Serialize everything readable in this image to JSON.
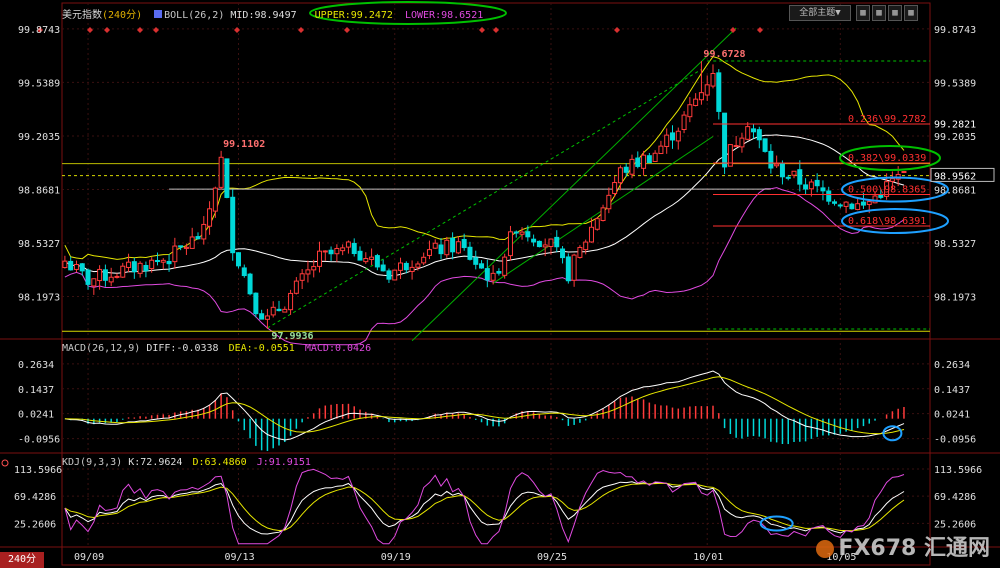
{
  "header": {
    "title": "美元指数",
    "period": "(240分)",
    "boll_label": "BOLL(26,2)",
    "mid": "MID:98.9497",
    "upper": "UPPER:99.2472",
    "lower": "LOWER:98.6521",
    "all_themes": "全部主题▼"
  },
  "macd_header": {
    "label": "MACD(26,12,9)",
    "diff": "DIFF:-0.0338",
    "dea": "DEA:-0.0551",
    "macd": "MACD:0.0426"
  },
  "kdj_header": {
    "label": "KDJ(9,3,3)",
    "k": "K:72.9624",
    "d": "D:63.4860",
    "j": "J:91.9151"
  },
  "period_badge": "240分",
  "watermark": "FX678 汇通网",
  "colors": {
    "up": "#ff3b3b",
    "down": "#00d8d8",
    "mid": "#ffffff",
    "upper": "#e6e600",
    "lower": "#e04ae0",
    "fib": "#ff3030",
    "highlight_green": "#00c000",
    "highlight_blue": "#1ea0ff"
  },
  "chart_data": [
    {
      "type": "candlestick",
      "title": "美元指数 (240分)",
      "y_ticks": [
        "99.8743",
        "99.5389",
        "99.2035",
        "98.8681",
        "98.5327",
        "98.1973"
      ],
      "y_tick_values": [
        99.8743,
        99.5389,
        99.2035,
        98.8681,
        98.5327,
        98.1973
      ],
      "ylim": [
        97.95,
        99.93
      ],
      "x_ticks": [
        "09/09",
        "09/13",
        "09/19",
        "09/25",
        "10/01",
        "10/05"
      ],
      "x_tick_index": [
        4,
        30,
        57,
        84,
        111,
        134
      ],
      "annotations": [
        {
          "text": "99.1102",
          "index": 27,
          "value": 99.1102
        },
        {
          "text": "97.9936",
          "index": 35,
          "value": 97.9936
        },
        {
          "text": "99.6728",
          "index": 110,
          "value": 99.6728
        }
      ],
      "fib_levels": [
        {
          "label": "0.236\\99.2782",
          "value": 99.2782
        },
        {
          "label": "0.382\\99.0339",
          "value": 99.0339
        },
        {
          "label": "0.500\\98.8365",
          "value": 98.8365
        },
        {
          "label": "0.618\\98.6391",
          "value": 98.6391
        }
      ],
      "right_labels": [
        {
          "text": "99.2821",
          "value": 99.2821
        },
        {
          "text": "98.9562",
          "value": 98.9562
        }
      ],
      "series": [
        {
          "name": "MID",
          "current": 98.9497
        },
        {
          "name": "UPPER",
          "current": 99.2472
        },
        {
          "name": "LOWER",
          "current": 98.6521
        }
      ]
    },
    {
      "type": "bar",
      "title": "MACD(26,12,9)",
      "y_ticks": [
        "0.2634",
        "0.1437",
        "0.0241",
        "-0.0956"
      ],
      "y_tick_values": [
        0.2634,
        0.1437,
        0.0241,
        -0.0956
      ],
      "ylim": [
        -0.16,
        0.33
      ],
      "series": [
        {
          "name": "DIFF",
          "current": -0.0338
        },
        {
          "name": "DEA",
          "current": -0.0551
        },
        {
          "name": "MACD",
          "current": 0.0426
        }
      ]
    },
    {
      "type": "line",
      "title": "KDJ(9,3,3)",
      "y_ticks": [
        "113.5966",
        "69.4286",
        "25.2606"
      ],
      "y_tick_values": [
        113.5966,
        69.4286,
        25.2606
      ],
      "ylim": [
        -10,
        125
      ],
      "series": [
        {
          "name": "K",
          "current": 72.9624
        },
        {
          "name": "D",
          "current": 63.486
        },
        {
          "name": "J",
          "current": 91.9151
        }
      ]
    }
  ]
}
